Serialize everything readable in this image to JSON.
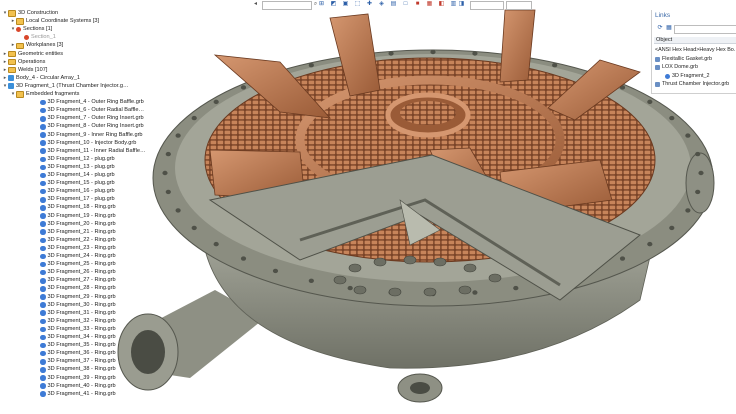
{
  "toolbar": {
    "search_placeholder": "",
    "icons": [
      "nav-back-icon",
      "nav-forward-icon",
      "filter-icon",
      "search-icon",
      "view-icon",
      "select-icon",
      "render-icon"
    ]
  },
  "tree": {
    "items": [
      {
        "label": "3D Construction",
        "icon": "folder",
        "level": 0,
        "expanded": true
      },
      {
        "label": "Local Coordinate Systems [3]",
        "icon": "folder",
        "level": 1,
        "expanded": false
      },
      {
        "label": "Sections [1]",
        "icon": "section",
        "level": 1,
        "expanded": true
      },
      {
        "label": "Section_1",
        "icon": "section",
        "level": 2,
        "dim": true
      },
      {
        "label": "Workplanes [3]",
        "icon": "folder",
        "level": 1,
        "expanded": false
      },
      {
        "label": "Geometric entities",
        "icon": "folder",
        "level": 0,
        "expanded": false
      },
      {
        "label": "Operations",
        "icon": "folder",
        "level": 0,
        "expanded": false
      },
      {
        "label": "Welds [107]",
        "icon": "folder",
        "level": 0,
        "expanded": false
      },
      {
        "label": "Body_4 - Circular Array_1",
        "icon": "body",
        "level": 0,
        "expanded": false
      },
      {
        "label": "3D Fragment_1 (Thrust Chamber Injector.g…",
        "icon": "body",
        "level": 0,
        "expanded": true
      },
      {
        "label": "Embedded fragments",
        "icon": "folder",
        "level": 1,
        "expanded": true
      }
    ],
    "fragments": [
      "3D Fragment_4 - Outer Ring Baffle.grb",
      "3D Fragment_6 - Outer Radial Baffle…",
      "3D Fragment_7 - Outer Ring Insert.grb",
      "3D Fragment_8 - Outer Ring Insert.grb",
      "3D Fragment_9 - Inner Ring Baffle.grb",
      "3D Fragment_10 - Injector Body.grb",
      "3D Fragment_11 - Inner Radial Baffle…",
      "3D Fragment_12 - plug.grb",
      "3D Fragment_13 - plug.grb",
      "3D Fragment_14 - plug.grb",
      "3D Fragment_15 - plug.grb",
      "3D Fragment_16 - plug.grb",
      "3D Fragment_17 - plug.grb",
      "3D Fragment_18 - Ring.grb",
      "3D Fragment_19 - Ring.grb",
      "3D Fragment_20 - Ring.grb",
      "3D Fragment_21 - Ring.grb",
      "3D Fragment_22 - Ring.grb",
      "3D Fragment_23 - Ring.grb",
      "3D Fragment_24 - Ring.grb",
      "3D Fragment_25 - Ring.grb",
      "3D Fragment_26 - Ring.grb",
      "3D Fragment_27 - Ring.grb",
      "3D Fragment_28 - Ring.grb",
      "3D Fragment_29 - Ring.grb",
      "3D Fragment_30 - Ring.grb",
      "3D Fragment_31 - Ring.grb",
      "3D Fragment_32 - Ring.grb",
      "3D Fragment_33 - Ring.grb",
      "3D Fragment_34 - Ring.grb",
      "3D Fragment_35 - Ring.grb",
      "3D Fragment_36 - Ring.grb",
      "3D Fragment_37 - Ring.grb",
      "3D Fragment_38 - Ring.grb",
      "3D Fragment_39 - Ring.grb",
      "3D Fragment_40 - Ring.grb",
      "3D Fragment_41 - Ring.grb"
    ]
  },
  "links": {
    "title": "Links",
    "column_header": "Object",
    "rows": [
      {
        "label": "<ANSI Hex Head>Heavy Hex Bo…",
        "level": 0,
        "icon": "none"
      },
      {
        "label": "Flexitallic Gasket.grb",
        "level": 0,
        "icon": "doc"
      },
      {
        "label": "LOX Dome.grb",
        "level": 0,
        "icon": "doc"
      },
      {
        "label": "3D Fragment_2",
        "level": 1,
        "icon": "frag"
      },
      {
        "label": "Thrust Chamber Injector.grb",
        "level": 0,
        "icon": "doc"
      }
    ]
  },
  "colors": {
    "background": "#ffffff",
    "body_gray": "#8b8d80",
    "copper": "#b8734a",
    "copper_dark": "#7a4428",
    "folder": "#f2c14e",
    "fragment_icon": "#3e7bd6"
  }
}
